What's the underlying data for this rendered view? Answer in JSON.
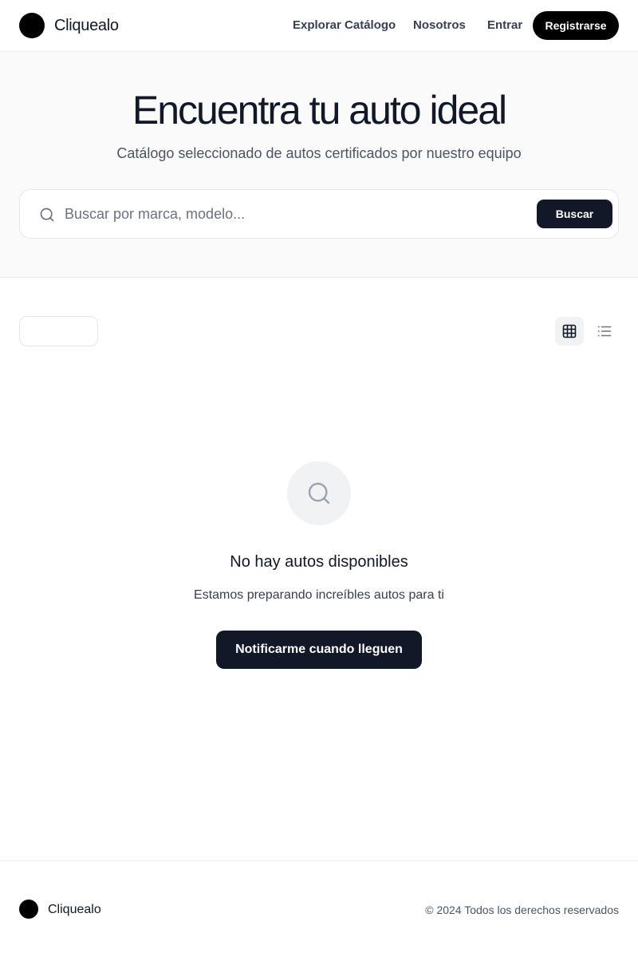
{
  "header": {
    "brand": "Cliquealo",
    "nav": {
      "explore": "Explorar Catálogo",
      "about": "Nosotros",
      "login": "Entrar"
    },
    "register_label": "Registrarse"
  },
  "hero": {
    "title": "Encuentra tu auto ideal",
    "subtitle": "Catálogo seleccionado de autos certificados por nuestro equipo",
    "search": {
      "placeholder": "Buscar por marca, modelo...",
      "value": "",
      "button_label": "Buscar",
      "icon": "search-icon"
    }
  },
  "toolbar": {
    "filter_value": "",
    "view_modes": [
      "grid-icon",
      "list-icon"
    ],
    "active_view": "grid"
  },
  "empty_state": {
    "icon": "search-icon",
    "title": "No hay autos disponibles",
    "description": "Estamos preparando increíbles autos para ti",
    "button_label": "Notificarme cuando lleguen"
  },
  "footer": {
    "brand": "Cliquealo",
    "copyright": "© 2024 Todos los derechos reservados"
  },
  "colors": {
    "primary": "#111827",
    "hero_background": "#fafafa",
    "muted_surface": "#f1f2f4",
    "border": "#e5e7eb"
  }
}
